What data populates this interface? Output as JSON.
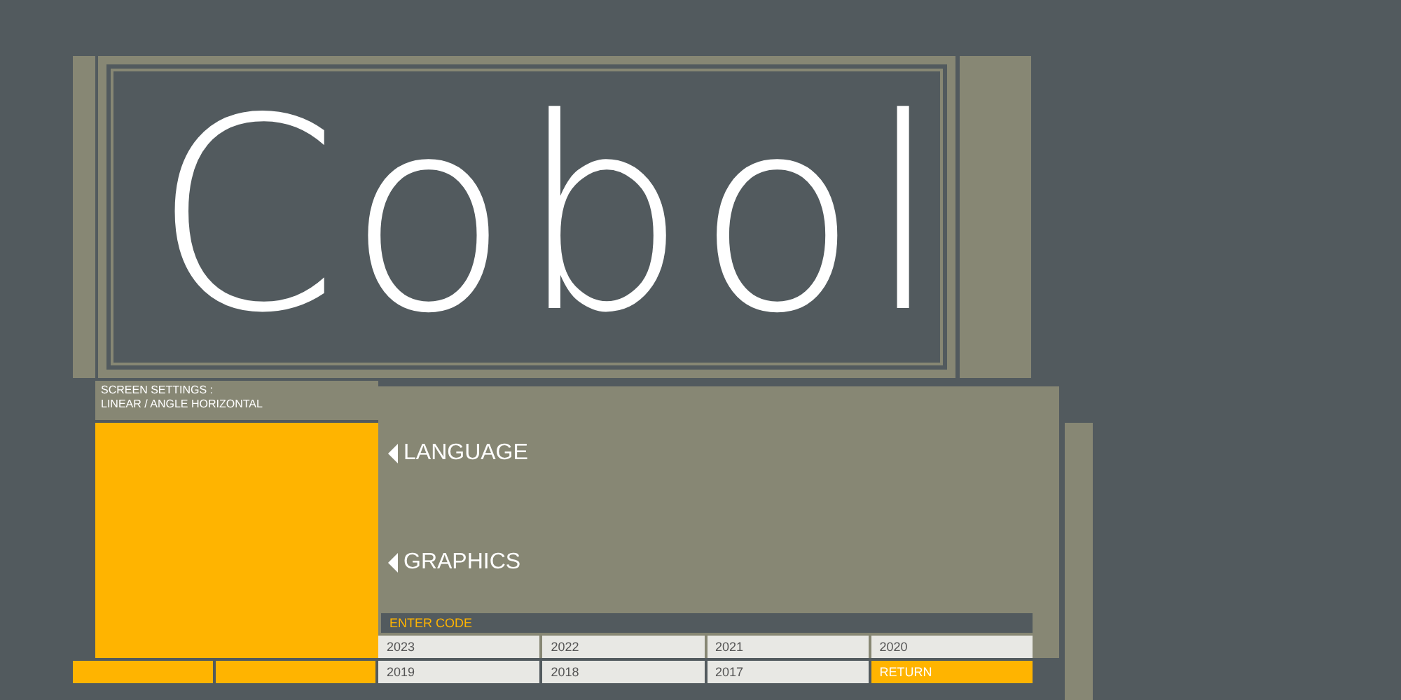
{
  "logo": {
    "text": "Cobol"
  },
  "settings": {
    "lines": [
      "SCREEN SETTINGS :",
      "LINEAR / ANGLE HORIZONTAL"
    ]
  },
  "menu": [
    {
      "label": "LANGUAGE"
    },
    {
      "label": "GRAPHICS"
    }
  ],
  "code_panel": {
    "label": "ENTER CODE",
    "keys": [
      {
        "label": "2023",
        "kind": "year"
      },
      {
        "label": "2022",
        "kind": "year"
      },
      {
        "label": "2021",
        "kind": "year"
      },
      {
        "label": "2020",
        "kind": "year"
      },
      {
        "label": "2019",
        "kind": "year"
      },
      {
        "label": "2018",
        "kind": "year"
      },
      {
        "label": "2017",
        "kind": "year"
      },
      {
        "label": "RETURN",
        "kind": "action"
      }
    ]
  }
}
